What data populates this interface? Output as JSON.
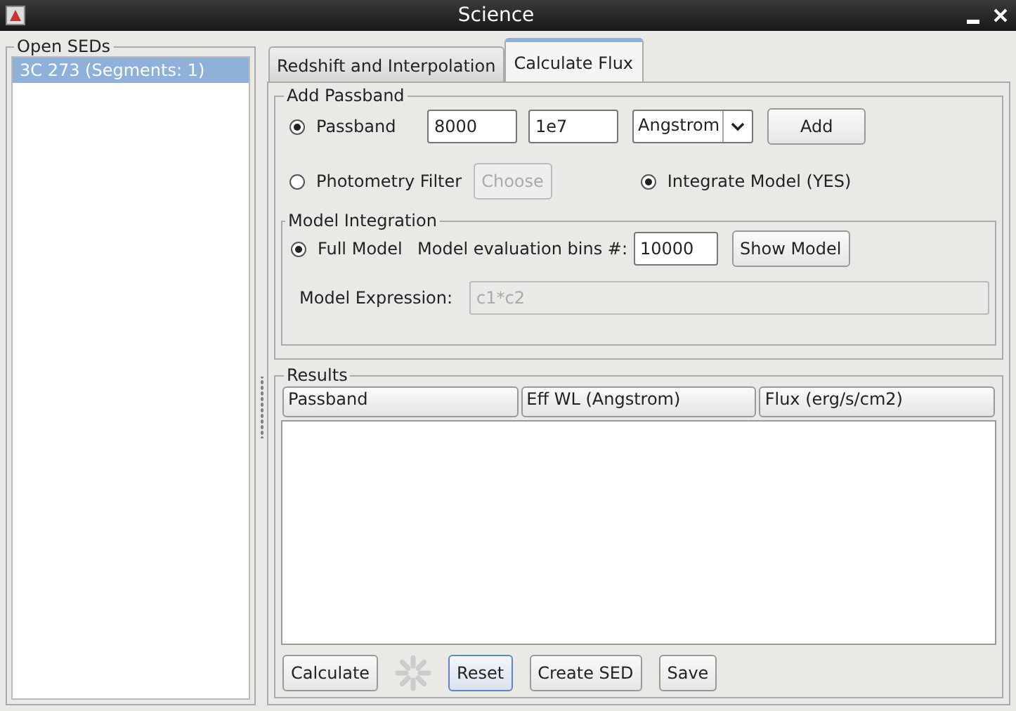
{
  "window": {
    "title": "Science"
  },
  "sed_list": {
    "title": "Open SEDs",
    "items": [
      {
        "label": "3C 273 (Segments: 1)",
        "selected": true
      }
    ]
  },
  "tabs": [
    {
      "label": "Redshift and Interpolation",
      "selected": false
    },
    {
      "label": "Calculate Flux",
      "selected": true
    }
  ],
  "add_passband": {
    "title": "Add Passband",
    "passband": {
      "label": "Passband",
      "selected": true,
      "min": "8000",
      "max": "1e7",
      "unit": "Angstrom",
      "button": "Add"
    },
    "photometry": {
      "label": "Photometry Filter",
      "selected": false,
      "button": "Choose",
      "disabled": true
    },
    "integrate": {
      "label": "Integrate Model (YES)",
      "selected": true
    },
    "model_integration": {
      "title": "Model Integration",
      "full_model": {
        "label": "Full Model",
        "selected": true
      },
      "bins_label": "Model evaluation bins #:",
      "bins": "10000",
      "button": "Show Model",
      "expression_label": "Model Expression:",
      "expression": "c1*c2",
      "disabled": true
    }
  },
  "results": {
    "title": "Results",
    "columns": [
      "Passband",
      "Eff WL (Angstrom)",
      "Flux (erg/s/cm2)"
    ]
  },
  "buttons": [
    {
      "label": "Calculate",
      "focused": false
    },
    {
      "label": "Reset",
      "focused": true
    },
    {
      "label": "Create SED",
      "focused": false
    },
    {
      "label": "Save",
      "focused": false
    }
  ]
}
